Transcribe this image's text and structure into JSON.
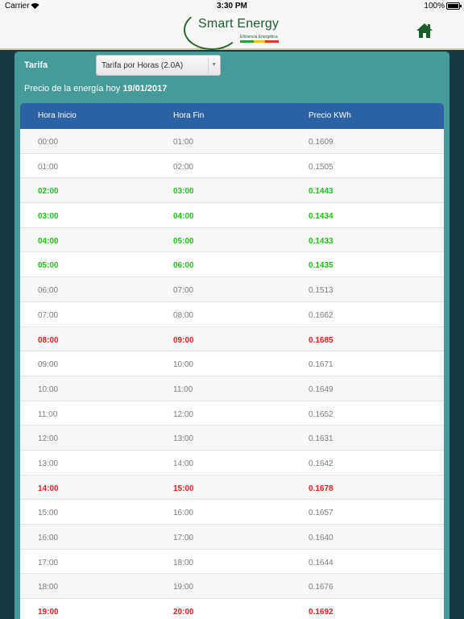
{
  "status_bar": {
    "carrier": "Carrier",
    "time": "3:30 PM",
    "battery": "100%"
  },
  "header": {
    "brand": "Smart Energy",
    "tagline": "Eficiencia Energética"
  },
  "tarifa": {
    "label": "Tarifa",
    "selected": "Tarifa por Horas (2.0A)"
  },
  "price_info": {
    "prefix": "Precio de la energía hoy",
    "date": "19/01/2017"
  },
  "colors": {
    "low_price": "#22c21a",
    "high_price": "#e81d1d",
    "header_bg": "#2a62a3",
    "panel_bg": "#449b98"
  },
  "table": {
    "headers": [
      "Hora Inicio",
      "Hora Fin",
      "Precio KWh"
    ],
    "rows": [
      {
        "start": "00:00",
        "end": "01:00",
        "price": "0.1609",
        "status": "normal"
      },
      {
        "start": "01:00",
        "end": "02:00",
        "price": "0.1505",
        "status": "normal"
      },
      {
        "start": "02:00",
        "end": "03:00",
        "price": "0.1443",
        "status": "low"
      },
      {
        "start": "03:00",
        "end": "04:00",
        "price": "0.1434",
        "status": "low"
      },
      {
        "start": "04:00",
        "end": "05:00",
        "price": "0.1433",
        "status": "low"
      },
      {
        "start": "05:00",
        "end": "06:00",
        "price": "0.1435",
        "status": "low"
      },
      {
        "start": "06:00",
        "end": "07:00",
        "price": "0.1513",
        "status": "normal"
      },
      {
        "start": "07:00",
        "end": "08:00",
        "price": "0.1662",
        "status": "normal"
      },
      {
        "start": "08:00",
        "end": "09:00",
        "price": "0.1685",
        "status": "high"
      },
      {
        "start": "09:00",
        "end": "10:00",
        "price": "0.1671",
        "status": "normal"
      },
      {
        "start": "10:00",
        "end": "11:00",
        "price": "0.1649",
        "status": "normal"
      },
      {
        "start": "11:00",
        "end": "12:00",
        "price": "0.1652",
        "status": "normal"
      },
      {
        "start": "12:00",
        "end": "13:00",
        "price": "0.1631",
        "status": "normal"
      },
      {
        "start": "13:00",
        "end": "14:00",
        "price": "0.1642",
        "status": "normal"
      },
      {
        "start": "14:00",
        "end": "15:00",
        "price": "0.1678",
        "status": "high"
      },
      {
        "start": "15:00",
        "end": "16:00",
        "price": "0.1657",
        "status": "normal"
      },
      {
        "start": "16:00",
        "end": "17:00",
        "price": "0.1640",
        "status": "normal"
      },
      {
        "start": "17:00",
        "end": "18:00",
        "price": "0.1644",
        "status": "normal"
      },
      {
        "start": "18:00",
        "end": "19:00",
        "price": "0.1676",
        "status": "normal"
      },
      {
        "start": "19:00",
        "end": "20:00",
        "price": "0.1692",
        "status": "high"
      }
    ]
  }
}
